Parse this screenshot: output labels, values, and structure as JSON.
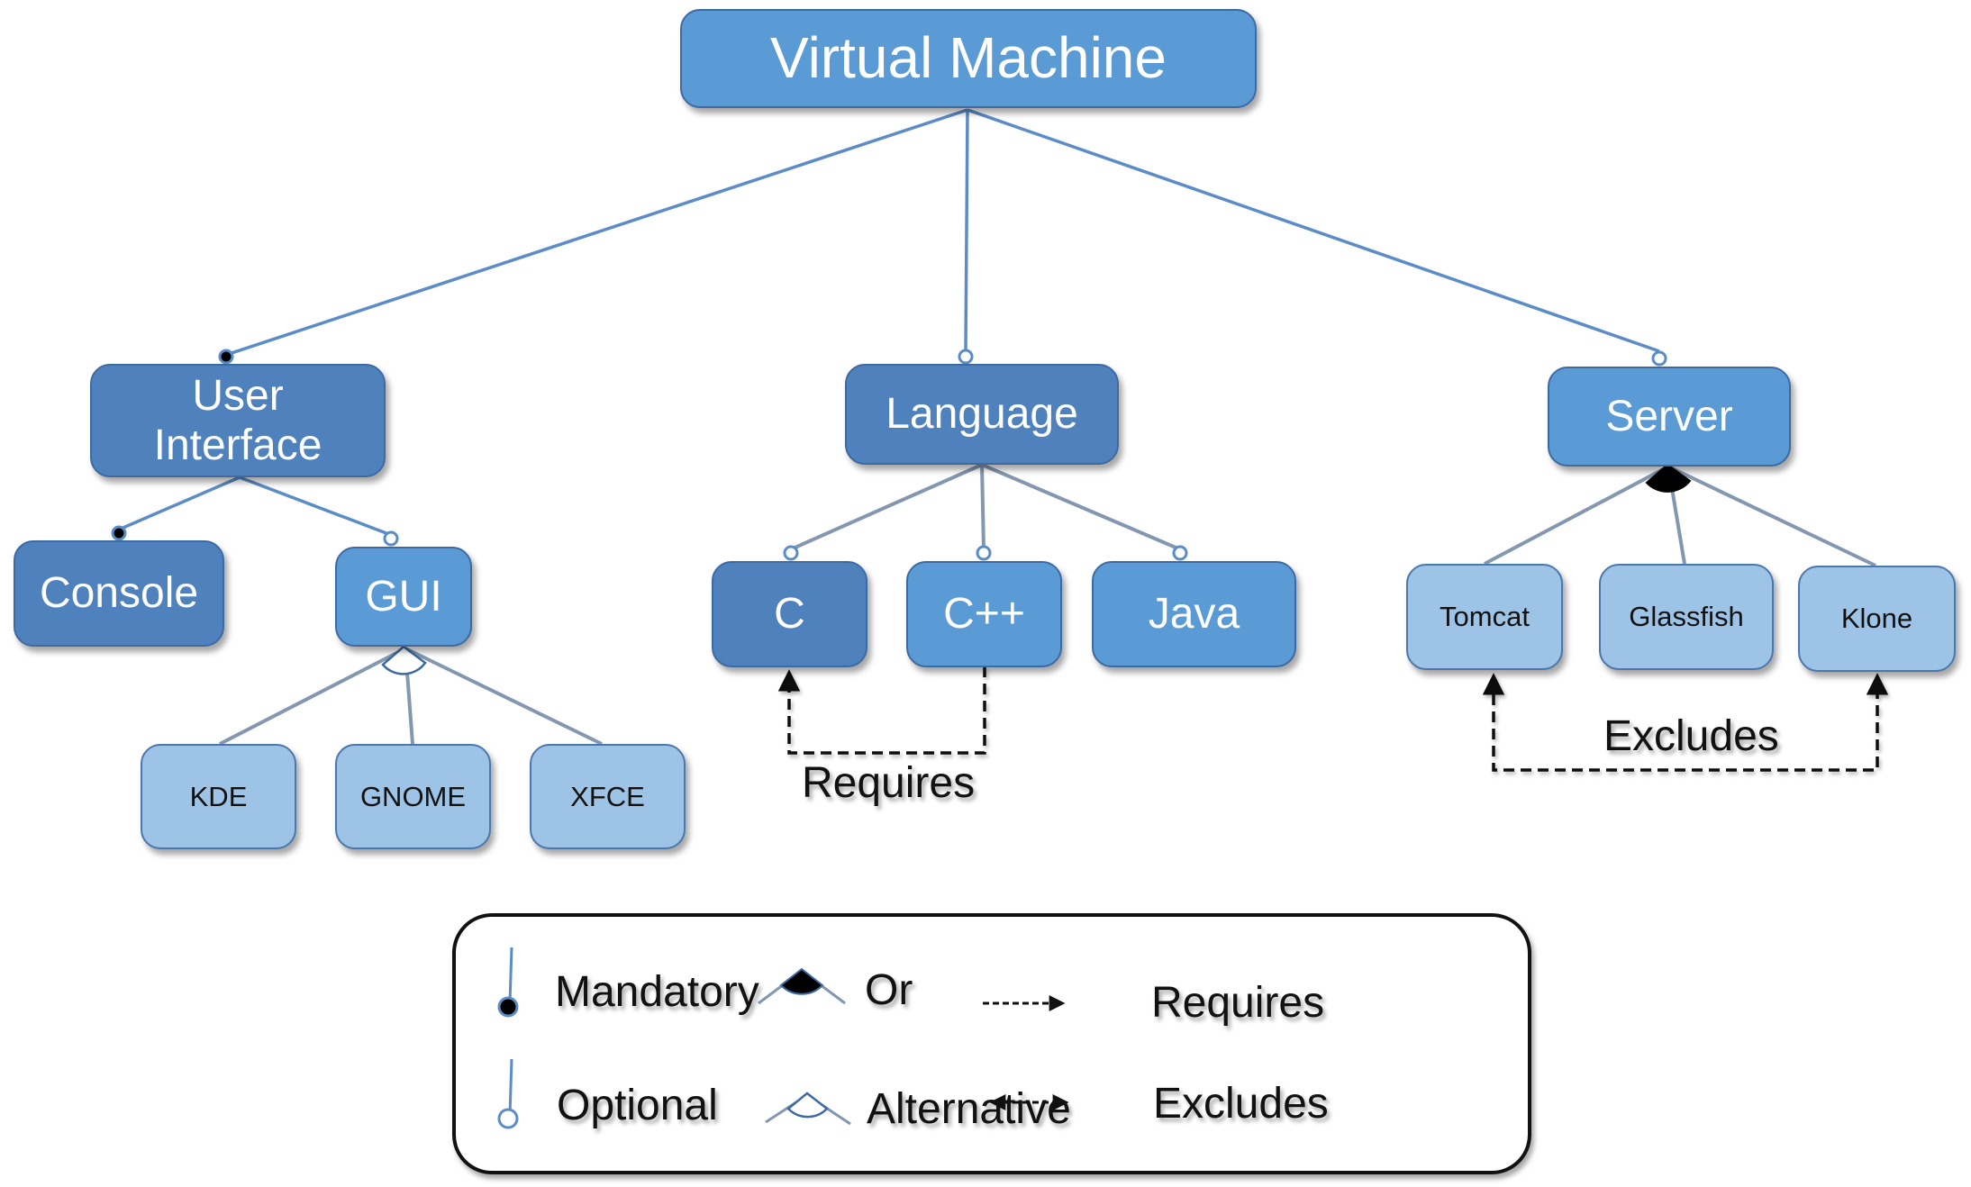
{
  "diagram": {
    "type": "feature-model",
    "root": {
      "id": "vm",
      "label": "Virtual Machine"
    },
    "features": [
      {
        "id": "ui",
        "label": "User Interface",
        "parent": "vm",
        "relation": "mandatory"
      },
      {
        "id": "lang",
        "label": "Language",
        "parent": "vm",
        "relation": "optional"
      },
      {
        "id": "server",
        "label": "Server",
        "parent": "vm",
        "relation": "optional"
      },
      {
        "id": "console",
        "label": "Console",
        "parent": "ui",
        "relation": "mandatory"
      },
      {
        "id": "gui",
        "label": "GUI",
        "parent": "ui",
        "relation": "optional"
      },
      {
        "id": "kde",
        "label": "KDE",
        "parent": "gui",
        "relation": "alternative"
      },
      {
        "id": "gnome",
        "label": "GNOME",
        "parent": "gui",
        "relation": "alternative"
      },
      {
        "id": "xfce",
        "label": "XFCE",
        "parent": "gui",
        "relation": "alternative"
      },
      {
        "id": "c",
        "label": "C",
        "parent": "lang",
        "relation": "optional"
      },
      {
        "id": "cpp",
        "label": "C++",
        "parent": "lang",
        "relation": "optional"
      },
      {
        "id": "java",
        "label": "Java",
        "parent": "lang",
        "relation": "optional"
      },
      {
        "id": "tomcat",
        "label": "Tomcat",
        "parent": "server",
        "relation": "or"
      },
      {
        "id": "glassfish",
        "label": "Glassfish",
        "parent": "server",
        "relation": "or"
      },
      {
        "id": "klone",
        "label": "Klone",
        "parent": "server",
        "relation": "or"
      }
    ],
    "constraints": [
      {
        "type": "requires",
        "from": "cpp",
        "to": "c",
        "label": "Requires"
      },
      {
        "type": "excludes",
        "from": "tomcat",
        "to": "klone",
        "label": "Excludes"
      }
    ],
    "colors": {
      "dark_node": "#4f81bd",
      "mid_node": "#5b9bd5",
      "light_node": "#9dc3e6",
      "edge": "#5b8cc7",
      "edge_grey": "#8497b0",
      "constraint": "#111111"
    }
  },
  "legend": {
    "items": [
      {
        "symbol": "mandatory-icon",
        "label": "Mandatory"
      },
      {
        "symbol": "or-icon",
        "label": "Or"
      },
      {
        "symbol": "requires-arrow-icon",
        "label": "Requires"
      },
      {
        "symbol": "optional-icon",
        "label": "Optional"
      },
      {
        "symbol": "alternative-icon",
        "label": "Alternative"
      },
      {
        "symbol": "excludes-arrow-icon",
        "label": "Excludes"
      }
    ]
  }
}
